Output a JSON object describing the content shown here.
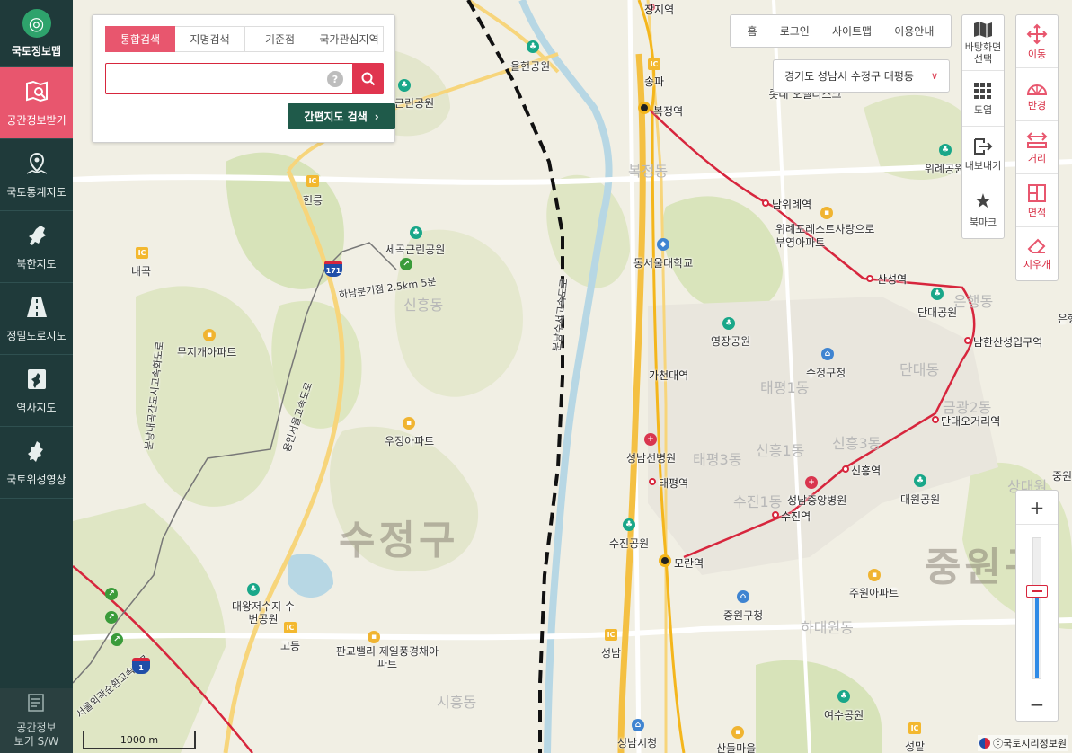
{
  "sidebar": {
    "logo": "국토정보맵",
    "items": [
      {
        "label": "공간정보받기",
        "icon": "map-search-icon",
        "active": true
      },
      {
        "label": "국토통계지도",
        "icon": "location-map-icon",
        "active": false
      },
      {
        "label": "북한지도",
        "icon": "north-korea-map-icon",
        "active": false
      },
      {
        "label": "정밀도로지도",
        "icon": "road-icon",
        "active": false
      },
      {
        "label": "역사지도",
        "icon": "korea-map-icon",
        "active": false
      },
      {
        "label": "국토위성영상",
        "icon": "korea-satellite-icon",
        "active": false
      }
    ],
    "bottom_line1": "공간정보",
    "bottom_line2": "보기 S/W"
  },
  "search": {
    "tabs": [
      "통합검색",
      "지명검색",
      "기준점",
      "국가관심지역"
    ],
    "active_tab": "통합검색",
    "input_value": "",
    "input_placeholder": "",
    "help_label": "?",
    "quick_button": "간편지도 검색"
  },
  "topnav": {
    "home": "홈",
    "login": "로그인",
    "sitemap": "사이트맵",
    "guide": "이용안내"
  },
  "location": {
    "value": "경기도 성남시 수정구 태평동"
  },
  "tools_left": [
    {
      "label": "바탕화면 선택",
      "icon": "map-folded-icon"
    },
    {
      "label": "도엽",
      "icon": "grid-icon"
    },
    {
      "label": "내보내기",
      "icon": "export-icon"
    },
    {
      "label": "북마크",
      "icon": "star-icon"
    }
  ],
  "tools_right": [
    {
      "label": "이동",
      "icon": "move-arrows-icon"
    },
    {
      "label": "반경",
      "icon": "radius-icon"
    },
    {
      "label": "거리",
      "icon": "distance-icon"
    },
    {
      "label": "면적",
      "icon": "area-icon"
    },
    {
      "label": "지우개",
      "icon": "eraser-icon"
    }
  ],
  "zoom": {
    "plus": "+",
    "minus": "−",
    "level_fraction": 0.62
  },
  "scale": "1000 m",
  "copyright": "ⓒ국토지리정보원",
  "map": {
    "district_labels": [
      "수정구",
      "중원구",
      "신흥동",
      "복정동",
      "태평1동",
      "태평3동",
      "신흥1동",
      "신흥3동",
      "단대동",
      "하대원동",
      "수진1동",
      "시흥동",
      "은행동",
      "금광2동",
      "상대원",
      "은행"
    ],
    "highway_labels": [
      "분당수서고속도로",
      "용인서울고속도로",
      "분당내곡간도시고속화도로",
      "서울외곽순환고속도로"
    ],
    "note_label": "하남분기점 2.5km 5분",
    "places": [
      "장지역",
      "송파",
      "복정역",
      "롯데 오벨리스크",
      "율현공원",
      "근린공원",
      "헌릉",
      "세곡근린공원",
      "내곡",
      "무지개아파트",
      "남위례역",
      "위례포레스트사랑으로 부영아파트",
      "위례공원",
      "산성역",
      "단대공원",
      "남한산성입구역",
      "영장공원",
      "동서울대학교",
      "가천대역",
      "수정구청",
      "우정아파트",
      "성남선병원",
      "태평역",
      "단대오거리역",
      "신흥역",
      "중원구",
      "성남중앙병원",
      "수진역",
      "대원공원",
      "수진공원",
      "모란역",
      "중원구청",
      "주원아파트",
      "대왕저수지 수변공원",
      "고등",
      "판교밸리 제일풍경채아파트",
      "성남",
      "성남시청",
      "여수공원",
      "산들마을",
      "성맡"
    ]
  }
}
